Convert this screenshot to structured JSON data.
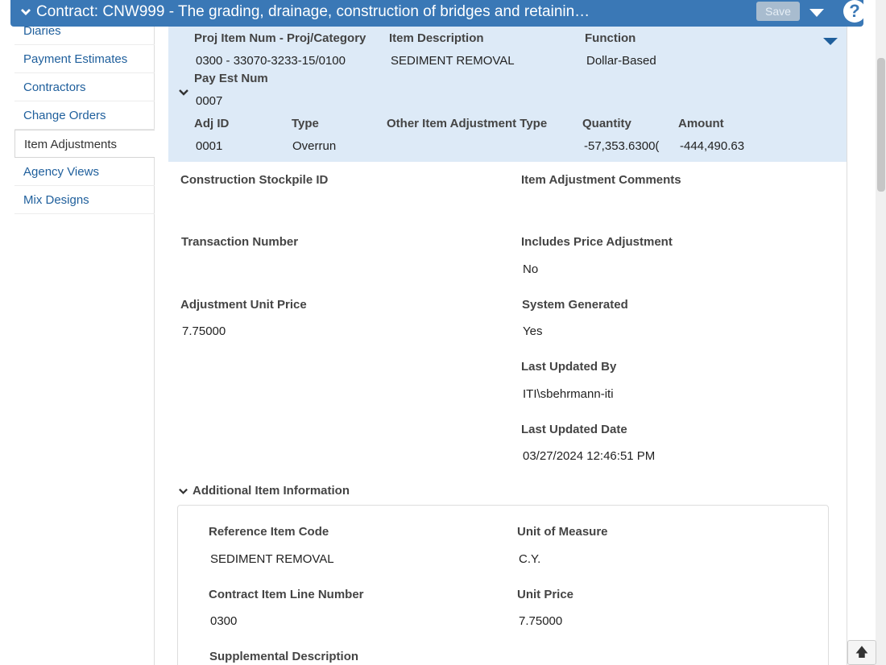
{
  "header": {
    "title": "Contract: CNW999 - The grading, drainage, construction of bridges and retainin…",
    "save_label": "Save",
    "help_label": "?"
  },
  "sidebar": {
    "items": [
      {
        "label": "Diaries"
      },
      {
        "label": "Payment Estimates"
      },
      {
        "label": "Contractors"
      },
      {
        "label": "Change Orders"
      },
      {
        "label": "Item Adjustments"
      },
      {
        "label": "Agency Views"
      },
      {
        "label": "Mix Designs"
      }
    ]
  },
  "summary": {
    "proj_item_label": "Proj Item Num - Proj/Category",
    "proj_item_value": "0300 - 33070-3233-15/0100",
    "item_desc_label": "Item Description",
    "item_desc_value": "SEDIMENT REMOVAL",
    "function_label": "Function",
    "function_value": "Dollar-Based",
    "pay_est_label": "Pay Est Num",
    "pay_est_value": "0007",
    "adj_id_label": "Adj ID",
    "adj_id_value": "0001",
    "type_label": "Type",
    "type_value": "Overrun",
    "other_type_label": "Other Item Adjustment Type",
    "quantity_label": "Quantity",
    "quantity_value": "-57,353.6300(",
    "amount_label": "Amount",
    "amount_value": "-444,490.63"
  },
  "details": {
    "stockpile_label": "Construction Stockpile ID",
    "comments_label": "Item Adjustment Comments",
    "transaction_label": "Transaction Number",
    "price_adj_label": "Includes Price Adjustment",
    "price_adj_value": "No",
    "unit_price_label": "Adjustment Unit Price",
    "unit_price_value": "7.75000",
    "system_gen_label": "System Generated",
    "system_gen_value": "Yes",
    "updated_by_label": "Last Updated By",
    "updated_by_value": "ITI\\sbehrmann-iti",
    "updated_date_label": "Last Updated Date",
    "updated_date_value": "03/27/2024 12:46:51 PM"
  },
  "additional": {
    "section_title": "Additional Item Information",
    "ref_code_label": "Reference Item Code",
    "ref_code_value": "SEDIMENT REMOVAL",
    "uom_label": "Unit of Measure",
    "uom_value": "C.Y.",
    "line_num_label": "Contract Item Line Number",
    "line_num_value": "0300",
    "unit_price_label": "Unit Price",
    "unit_price_value": "7.75000",
    "supp_desc_label": "Supplemental Description"
  },
  "colors": {
    "header_bg": "#3a78b6",
    "summary_bg": "#ddeaf7",
    "link": "#1f5f9c"
  }
}
